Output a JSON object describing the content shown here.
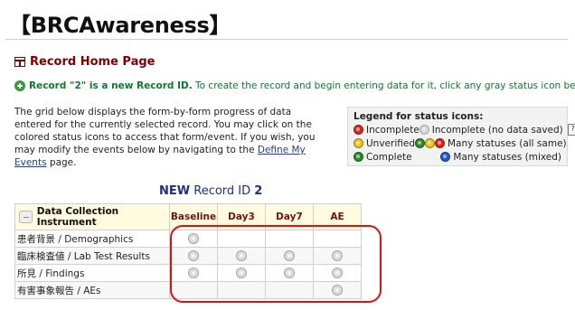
{
  "page_title": "【BRCAwareness】",
  "record_home": {
    "title": "Record Home Page",
    "icon": "table-icon"
  },
  "new_record": {
    "bold_text": "Record \"2\" is a new Record ID.",
    "rest_text": " To create the record and begin entering data for it, click any gray status icon below."
  },
  "description": {
    "text": "The grid below displays the form-by-form progress of data entered for the currently selected record. You may click on the colored status icons to access that form/event. If you wish, you may modify the events below by navigating to the ",
    "link": "Define My Events",
    "suffix": " page."
  },
  "legend": {
    "title": "Legend for status icons:",
    "incomplete": "Incomplete",
    "incomplete_no_data": "Incomplete (no data saved)",
    "help": "?",
    "unverified": "Unverified",
    "many_same": "Many statuses (all same)",
    "complete": "Complete",
    "many_mixed": "Many statuses (mixed)",
    "colors": {
      "incomplete": "#d42b1e",
      "unverified": "#f2c21b",
      "complete": "#2b8a2b",
      "mixed": "#2255d6",
      "no_data": "#d5d5d5"
    }
  },
  "grid": {
    "title_bold": "NEW",
    "title_mid": " Record ID ",
    "record_id": "2",
    "header_instrument": "Data Collection Instrument",
    "events": [
      "Baseline",
      "Day3",
      "Day7",
      "AE"
    ],
    "rows": [
      {
        "name": "患者背景 / Demographics",
        "status": [
          "gray",
          "",
          "",
          ""
        ]
      },
      {
        "name": "臨床検査値 / Lab Test Results",
        "status": [
          "gray",
          "gray",
          "gray",
          "gray"
        ]
      },
      {
        "name": "所見 / Findings",
        "status": [
          "gray",
          "gray",
          "gray",
          "gray"
        ]
      },
      {
        "name": "有害事象報告 / AEs",
        "status": [
          "",
          "",
          "",
          "gray"
        ]
      }
    ]
  },
  "colors": {
    "accent": "#800000",
    "link": "#1a3fa6",
    "success": "#0a7d2c",
    "highlight": "#e01010"
  }
}
